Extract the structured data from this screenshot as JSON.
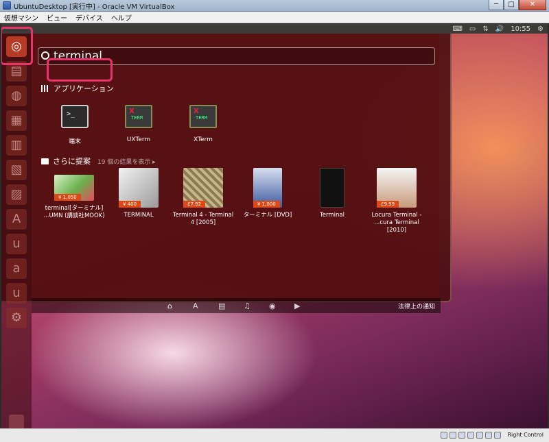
{
  "window": {
    "title": "UbuntuDesktop [実行中] - Oracle VM VirtualBox",
    "buttons": [
      "─",
      "□",
      "✕"
    ]
  },
  "menubar": [
    "仮想マシン",
    "ビュー",
    "デバイス",
    "ヘルプ"
  ],
  "panel": {
    "indicators": [
      "⌨",
      "▭",
      "⇅",
      "🔊"
    ],
    "clock": "10:55",
    "gear": "⚙"
  },
  "search": {
    "query": "terminal"
  },
  "applications": {
    "heading": "アプリケーション",
    "items": [
      {
        "label": "端末",
        "icon": "terminal-icon"
      },
      {
        "label": "UXTerm",
        "icon": "xterm-icon"
      },
      {
        "label": "XTerm",
        "icon": "xterm-icon"
      }
    ]
  },
  "suggestions": {
    "heading": "さらに提案",
    "subheading": "19 個の結果を表示 ▸",
    "items": [
      {
        "label1": "terminal[ターミナル]",
        "label2": "...UMN (講談社MOOK)",
        "price": "¥ 1,050"
      },
      {
        "label1": "TERMINAL",
        "label2": "",
        "price": "¥ 400"
      },
      {
        "label1": "Terminal 4 - Terminal",
        "label2": "4 [2005]",
        "price": "£7.92"
      },
      {
        "label1": "ターミナル [DVD]",
        "label2": "",
        "price": "¥ 1,000"
      },
      {
        "label1": "Terminal",
        "label2": "",
        "price": ""
      },
      {
        "label1": "Locura Terminal -",
        "label2": "...cura Terminal [2010]",
        "price": "£9.99"
      }
    ]
  },
  "footer": {
    "lenses": [
      "⌂",
      "A",
      "▤",
      "♫",
      "◉",
      "▶"
    ],
    "legal": "法律上の通知"
  },
  "statusbar": {
    "hostkey": "Right Control"
  },
  "colors": {
    "ubuntu_orange": "#dd4814",
    "highlight": "#e8336d"
  }
}
